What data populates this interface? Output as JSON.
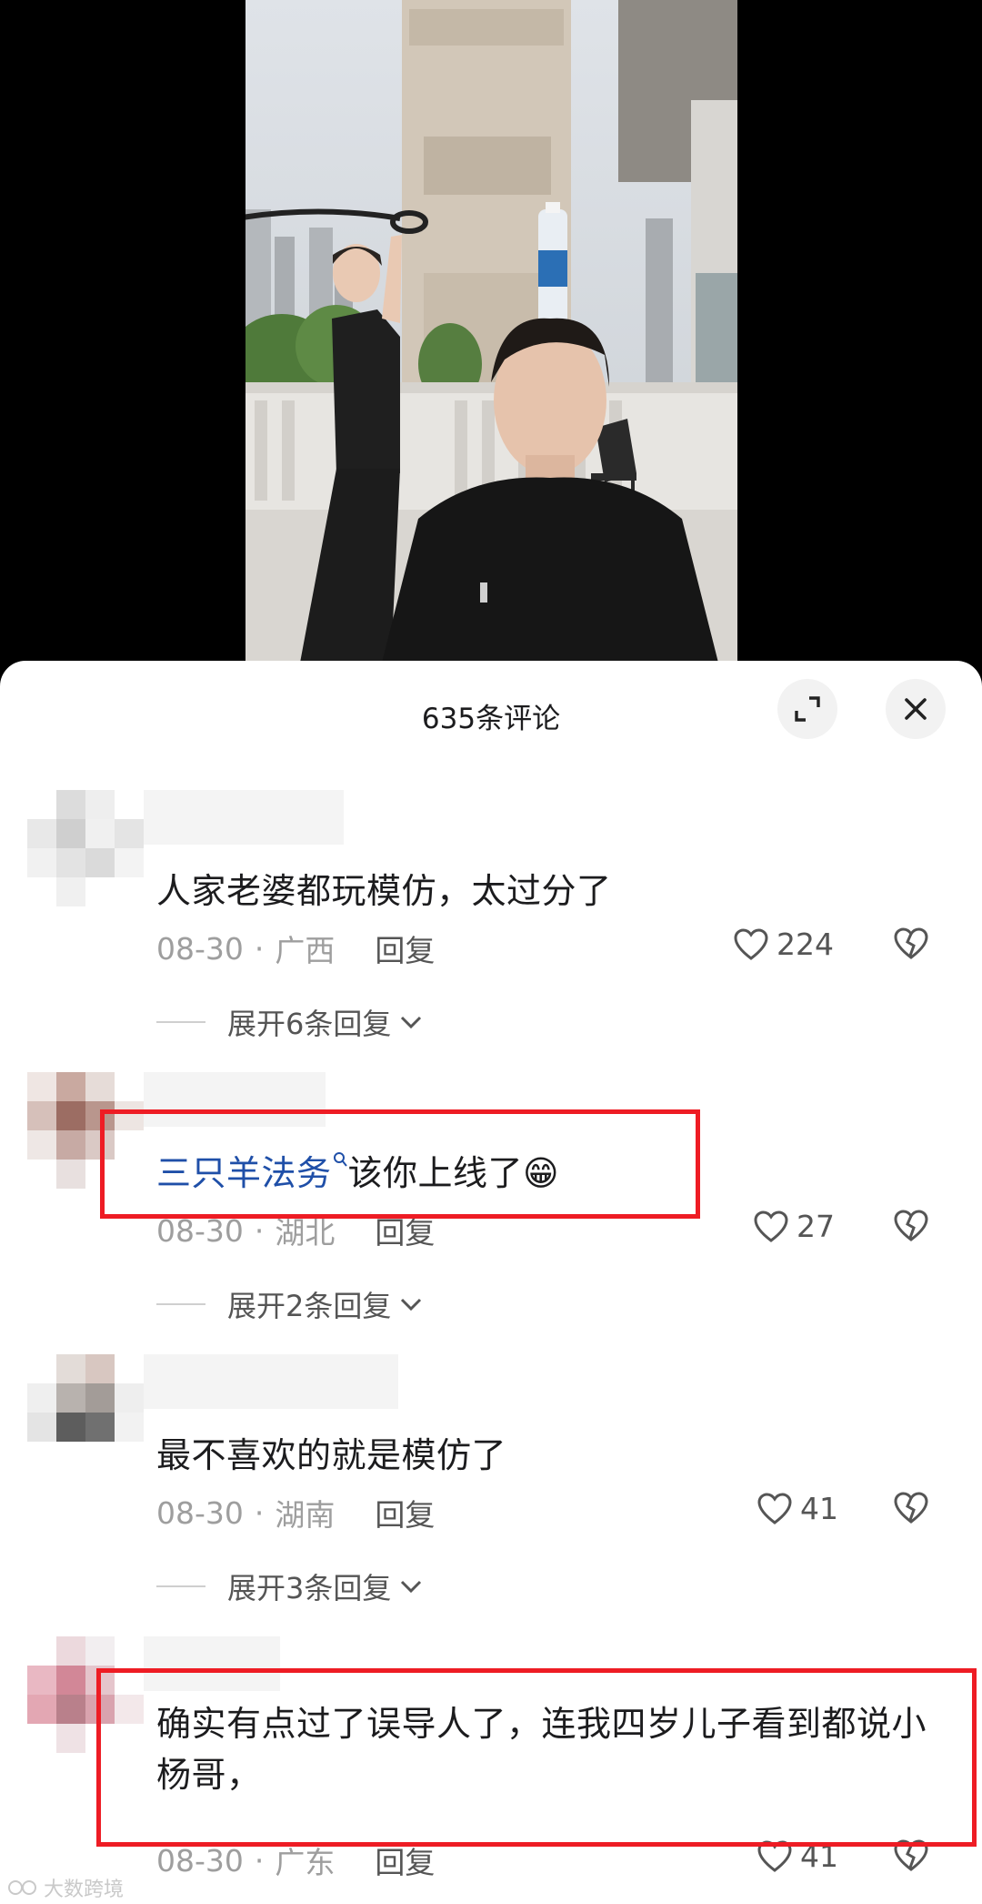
{
  "header": {
    "title": "635条评论"
  },
  "icons": {
    "expand": "expand-arrows-icon",
    "close": "close-icon",
    "like": "heart-outline-icon",
    "dislike": "broken-heart-icon",
    "chevron": "chevron-down-icon",
    "search": "search-icon"
  },
  "colors": {
    "highlight_box": "#ee1c24",
    "mention": "#1f4fa8"
  },
  "comments": [
    {
      "text": "人家老婆都玩模仿，太过分了",
      "date": "08-30",
      "location": "广西",
      "reply": "回复",
      "likes": "224",
      "expand": "展开6条回复"
    },
    {
      "mention": "三只羊法务",
      "text": "该你上线了",
      "emoji": "😁",
      "date": "08-30",
      "location": "湖北",
      "reply": "回复",
      "likes": "27",
      "expand": "展开2条回复"
    },
    {
      "text": "最不喜欢的就是模仿了",
      "date": "08-30",
      "location": "湖南",
      "reply": "回复",
      "likes": "41",
      "expand": "展开3条回复"
    },
    {
      "text": "确实有点过了误导人了，连我四岁儿子看到都说小杨哥，",
      "date": "08-30",
      "location": "广东",
      "reply": "回复",
      "likes": "41"
    }
  ],
  "watermark": "大数跨境"
}
